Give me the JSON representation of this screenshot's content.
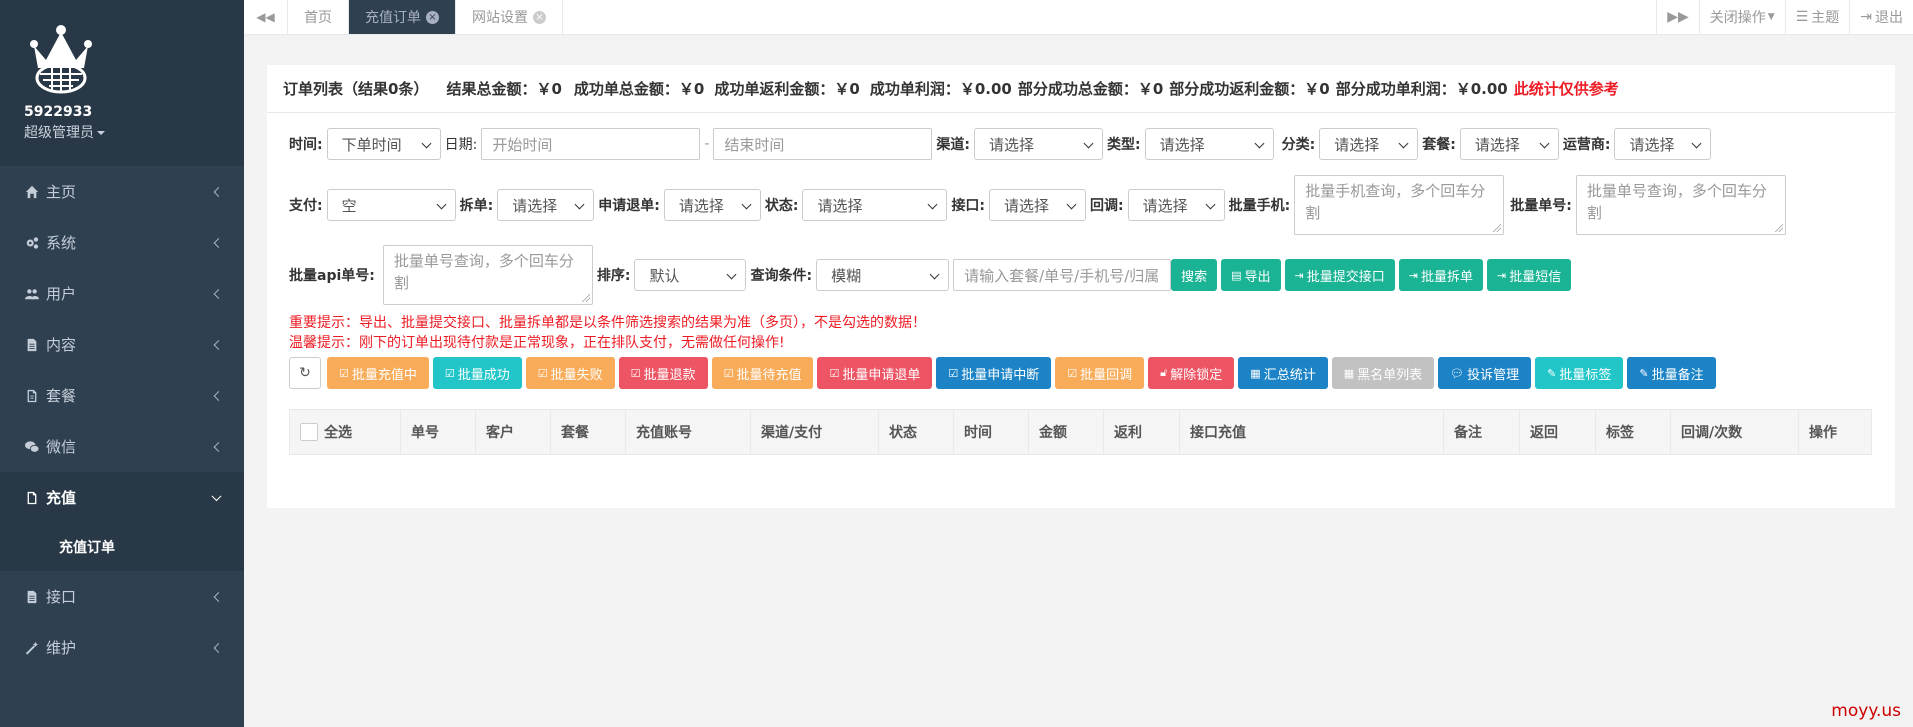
{
  "sidebar": {
    "user_id": "5922933",
    "role": "超级管理员",
    "items": [
      {
        "label": "主页"
      },
      {
        "label": "系统"
      },
      {
        "label": "用户"
      },
      {
        "label": "内容"
      },
      {
        "label": "套餐"
      },
      {
        "label": "微信"
      },
      {
        "label": "充值"
      },
      {
        "label": "接口"
      },
      {
        "label": "维护"
      }
    ],
    "sub_item": "充值订单"
  },
  "topbar": {
    "tabs": [
      {
        "label": "首页"
      },
      {
        "label": "充值订单"
      },
      {
        "label": "网站设置"
      }
    ],
    "close_ops": "关闭操作",
    "theme": "主题",
    "logout": "退出"
  },
  "summary": {
    "title": "订单列表（结果0条）",
    "total": "结果总金额：￥0",
    "success_total": "成功单总金额：￥0",
    "success_rebate": "成功单返利金额：￥0",
    "success_profit": "成功单利润：￥0.00",
    "partial_total": "部分成功总金额：￥0",
    "partial_rebate": "部分成功返利金额：￥0",
    "partial_profit": "部分成功单利润：￥0.00",
    "warn": "此统计仅供参考"
  },
  "filters": {
    "time_label": "时间:",
    "time_value": "下单时间",
    "date_label": "日期:",
    "start_placeholder": "开始时间",
    "dash": "-",
    "end_placeholder": "结束时间",
    "channel_label": "渠道:",
    "channel_value": "请选择",
    "type_label": "类型:",
    "type_value": "请选择",
    "category_label": "分类:",
    "category_value": "请选择",
    "package_label": "套餐:",
    "package_value": "请选择",
    "operator_label": "运营商:",
    "operator_value": "请选择",
    "pay_label": "支付:",
    "pay_value": "空",
    "split_label": "拆单:",
    "split_value": "请选择",
    "refund_label": "申请退单:",
    "refund_value": "请选择",
    "status_label": "状态:",
    "status_value": "请选择",
    "api_label": "接口:",
    "api_value": "请选择",
    "callback_label": "回调:",
    "callback_value": "请选择",
    "batch_phone_label": "批量手机:",
    "batch_phone_placeholder": "批量手机查询，多个回车分割",
    "batch_order_label": "批量单号:",
    "batch_order_placeholder": "批量单号查询，多个回车分割",
    "batch_api_label": "批量api单号:",
    "batch_api_placeholder": "批量单号查询，多个回车分割",
    "sort_label": "排序:",
    "sort_value": "默认",
    "cond_label": "查询条件:",
    "cond_value": "模糊",
    "keyword_placeholder": "请输入套餐/单号/手机号/归属",
    "search_btn": "搜索",
    "export_btn": "导出",
    "batch_submit_btn": "批量提交接口",
    "batch_split_btn": "批量拆单",
    "batch_sms_btn": "批量短信"
  },
  "tips": {
    "line1": "重要提示：导出、批量提交接口、批量拆单都是以条件筛选搜索的结果为准（多页），不是勾选的数据！",
    "line2": "温馨提示：刚下的订单出现待付款是正常现象，正在排队支付，无需做任何操作!"
  },
  "actions": [
    {
      "label": "批量充值中"
    },
    {
      "label": "批量成功"
    },
    {
      "label": "批量失败"
    },
    {
      "label": "批量退款"
    },
    {
      "label": "批量待充值"
    },
    {
      "label": "批量申请退单"
    },
    {
      "label": "批量申请中断"
    },
    {
      "label": "批量回调"
    },
    {
      "label": "解除锁定"
    },
    {
      "label": "汇总统计"
    },
    {
      "label": "黑名单列表"
    },
    {
      "label": "投诉管理"
    },
    {
      "label": "批量标签"
    },
    {
      "label": "批量备注"
    }
  ],
  "table": {
    "columns": [
      "全选",
      "单号",
      "客户",
      "套餐",
      "充值账号",
      "渠道/支付",
      "状态",
      "时间",
      "金额",
      "返利",
      "接口充值",
      "备注",
      "返回",
      "标签",
      "回调/次数",
      "操作"
    ]
  },
  "watermark": "moyy.us",
  "colors": {
    "sidebar": "#2f4050",
    "primary": "#1ab394",
    "warning": "#f8ac59",
    "info": "#23c6c8",
    "danger": "#ed5565",
    "blue": "#1c84c6"
  }
}
